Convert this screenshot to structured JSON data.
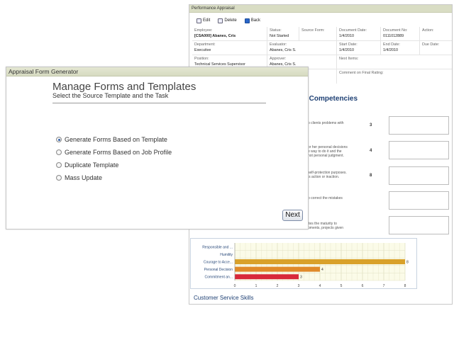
{
  "back_window": {
    "title": "Performance Appraisal",
    "toolbar": {
      "edit": "Edit",
      "delete": "Delete",
      "back": "Back"
    },
    "fields": {
      "employee_label": "Employee:",
      "employee_value": "[CSA000] Abanes, Cris",
      "status_label": "Status:",
      "status_value": "Not Started",
      "source_form_label": "Source Form:",
      "document_date_label": "Document Date:",
      "document_date_value": "1/4/2010",
      "document_no_label": "Document No:",
      "document_no_value": "0111012889",
      "action_label": "Action:",
      "department_label": "Department:",
      "department_value": "Executive",
      "evaluator_label": "Evaluator:",
      "evaluator_value": "Abanes, Cris S.",
      "start_date_label": "Start Date:",
      "start_date_value": "1/4/2010",
      "end_date_label": "End Date:",
      "end_date_value": "1/4/2010",
      "due_date_label": "Due Date:",
      "position_label": "Position:",
      "position_value": "Technical Services Supervisor",
      "approver_label": "Approver:",
      "approver_value": "Abanes, Cris S.",
      "next_items_label": "Next Items:",
      "comment_final_label": "Comment on Final Rating:"
    },
    "competencies_heading": "te Competencies",
    "questions": [
      {
        "text": "o clients problems with",
        "score": "3"
      },
      {
        "text": "or her personal decisions\ne way to do it and the\nnot personal judgment.",
        "score": "4"
      },
      {
        "text": "self-protection purposes.\nis action or inaction.",
        "score": "8"
      },
      {
        "text": "o correct the mistakes",
        "score": ""
      },
      {
        "text": "ites the maturity to\npments, projects given",
        "score": ""
      }
    ],
    "customer_service_heading": "Customer Service Skills"
  },
  "chart_data": {
    "type": "bar",
    "orientation": "horizontal",
    "categories": [
      "Responsible and ...",
      "Humility",
      "Courage to Acce...",
      "Personal Decision",
      "Commitment an..."
    ],
    "values": [
      null,
      null,
      8,
      4,
      3
    ],
    "data_labels": [
      "",
      "",
      "8",
      "4",
      "3"
    ],
    "x_ticks": [
      "0",
      "1",
      "2",
      "3",
      "4",
      "5",
      "6",
      "7",
      "8"
    ],
    "xlim": [
      0,
      8
    ],
    "grid": true,
    "colors": [
      "#d9a12a",
      "#d9a12a",
      "#d9a12a",
      "#e08a2a",
      "#d8283a"
    ]
  },
  "front_window": {
    "title": "Appraisal Form Generator",
    "heading": "Manage Forms and Templates",
    "subheading": "Select the Source Template and the Task",
    "options": [
      {
        "label": "Generate Forms Based on Template",
        "selected": true
      },
      {
        "label": "Generate Forms Based on Job Profile",
        "selected": false
      },
      {
        "label": "Duplicate Template",
        "selected": false
      },
      {
        "label": "Mass Update",
        "selected": false
      }
    ],
    "next_label": "Next"
  }
}
